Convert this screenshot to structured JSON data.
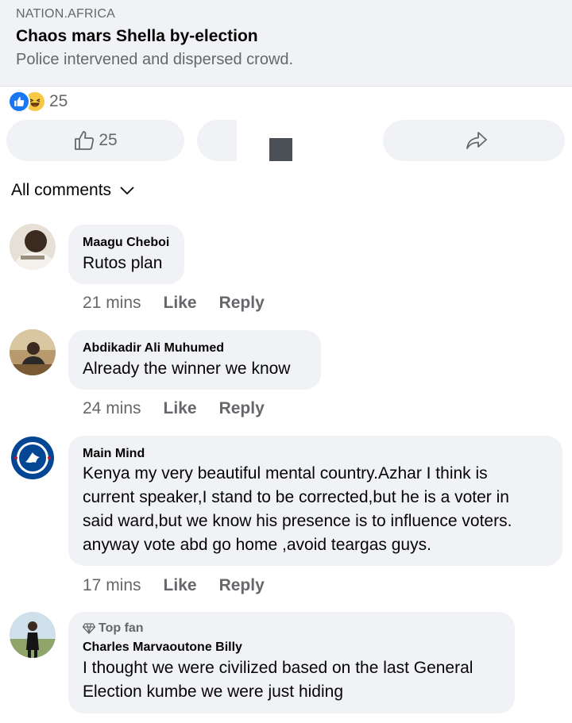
{
  "link_preview": {
    "source": "NATION.AFRICA",
    "title": "Chaos mars Shella by-election",
    "description": "Police intervened and dispersed crowd."
  },
  "reactions": {
    "icons": [
      "like-icon",
      "haha-icon"
    ],
    "count": "25"
  },
  "actions": {
    "like_count": "25",
    "share_icon": "share-icon"
  },
  "comments_filter": {
    "label": "All comments"
  },
  "comments": [
    {
      "author": "Maagu Cheboi",
      "text": "Rutos plan",
      "time": "21 mins",
      "like_label": "Like",
      "reply_label": "Reply"
    },
    {
      "author": "Abdikadir Ali Muhumed",
      "text": "Already the winner we know",
      "time": "24 mins",
      "like_label": "Like",
      "reply_label": "Reply"
    },
    {
      "author": "Main Mind",
      "text": "Kenya my very beautiful mental country.Azhar I think is\ncurrent speaker,I stand to be corrected,but he is a voter in\nsaid ward,but we know his presence is to influence voters.\nanyway vote abd go home ,avoid teargas guys.",
      "time": "17 mins",
      "like_label": "Like",
      "reply_label": "Reply"
    },
    {
      "badge": "Top fan",
      "author": "Charles Marvaoutone Billy",
      "text": "I thought we were civilized based on the last General\nElection kumbe we were just hiding"
    }
  ],
  "colors": {
    "background": "#ffffff",
    "bubble": "#f0f2f5",
    "secondary_text": "#65676b",
    "like_blue": "#1877f2",
    "haha_yellow": "#f7c843"
  }
}
